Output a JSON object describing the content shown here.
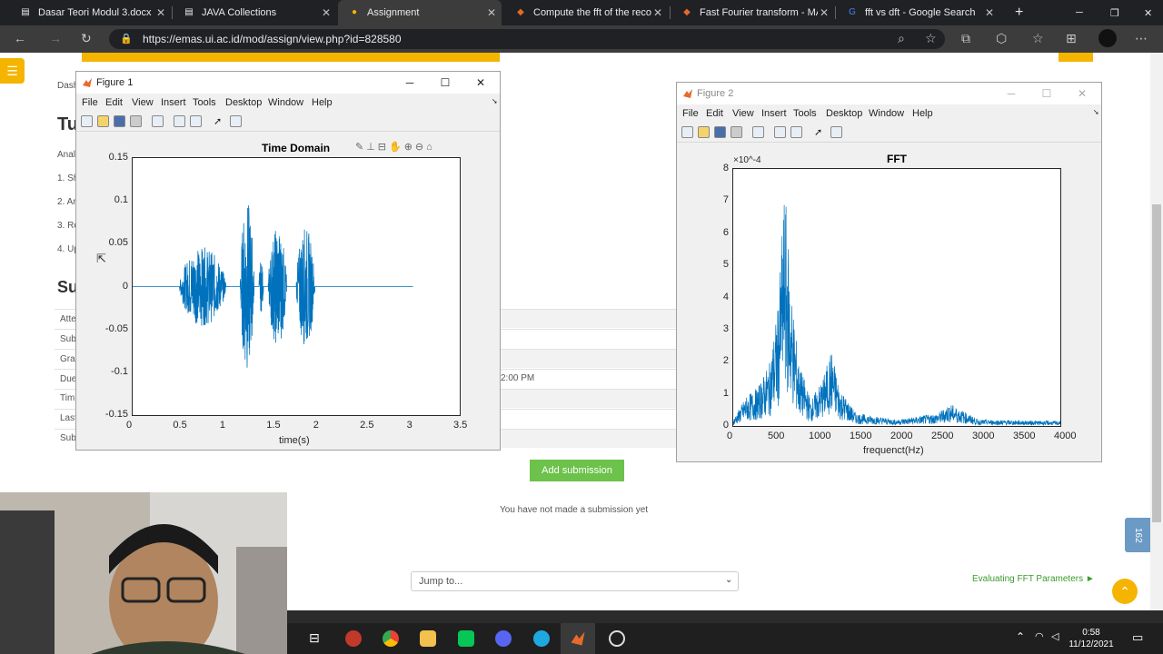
{
  "browser": {
    "tabs": [
      {
        "title": "Dasar Teori Modul 3.docx",
        "icon": "document-icon"
      },
      {
        "title": "JAVA Collections",
        "icon": "document-icon"
      },
      {
        "title": "Assignment",
        "icon": "moodle-icon"
      },
      {
        "title": "Compute the fft of the recon",
        "icon": "matlab-icon"
      },
      {
        "title": "Fast Fourier transform - MAT",
        "icon": "matlab-icon"
      },
      {
        "title": "fft vs dft - Google Search",
        "icon": "google-icon"
      }
    ],
    "new_tab_label": "+",
    "url": "https://emas.ui.ac.id/mod/assign/view.php?id=828580"
  },
  "moodle": {
    "breadcrumb": "Dash",
    "heading_partial": "Tu",
    "subheading_partial": "Su",
    "intro_partial": "Anal",
    "steps": [
      "1. Sh",
      "2. Ar",
      "3. Re",
      "4. Up"
    ],
    "status_rows": [
      "Atte",
      "Sub",
      "Gra",
      "Due",
      "Tim",
      "Last",
      "Sub"
    ],
    "due_time_partial": "2:00 PM",
    "add_submission_label": "Add submission",
    "no_submission_text": "You have not made a submission yet",
    "jump_to_placeholder": "Jump to...",
    "next_activity_label": "Evaluating FFT Parameters ►",
    "side_badge": "162"
  },
  "figure1": {
    "window_title": "Figure 1",
    "menu": [
      "File",
      "Edit",
      "View",
      "Insert",
      "Tools",
      "Desktop",
      "Window",
      "Help"
    ],
    "chart_data": {
      "type": "line",
      "title": "Time Domain",
      "xlabel": "time(s)",
      "ylabel": "",
      "xlim": [
        0,
        3.5
      ],
      "ylim": [
        -0.15,
        0.15
      ],
      "xticks": [
        "0",
        "0.5",
        "1",
        "1.5",
        "2",
        "2.5",
        "3",
        "3.5"
      ],
      "yticks": [
        "0.15",
        "0.1",
        "0.05",
        "0",
        "-0.05",
        "-0.1",
        "-0.15"
      ],
      "color": "#0072bd",
      "segments": [
        {
          "t0": 0.0,
          "t1": 0.5,
          "amp": 0.0
        },
        {
          "t0": 0.5,
          "t1": 1.0,
          "amp": 0.046
        },
        {
          "t0": 1.0,
          "t1": 1.15,
          "amp": 0.0
        },
        {
          "t0": 1.15,
          "t1": 1.3,
          "amp": 0.1
        },
        {
          "t0": 1.3,
          "t1": 1.35,
          "amp": 0.0
        },
        {
          "t0": 1.35,
          "t1": 1.4,
          "amp": 0.03
        },
        {
          "t0": 1.4,
          "t1": 1.45,
          "amp": 0.0
        },
        {
          "t0": 1.45,
          "t1": 1.65,
          "amp": 0.07
        },
        {
          "t0": 1.65,
          "t1": 1.75,
          "amp": 0.0
        },
        {
          "t0": 1.75,
          "t1": 1.95,
          "amp": 0.07
        },
        {
          "t0": 1.95,
          "t1": 3.0,
          "amp": 0.0
        }
      ]
    }
  },
  "figure2": {
    "window_title": "Figure 2",
    "menu": [
      "File",
      "Edit",
      "View",
      "Insert",
      "Tools",
      "Desktop",
      "Window",
      "Help"
    ],
    "chart_data": {
      "type": "line",
      "title": "FFT",
      "xlabel": "frequenct(Hz)",
      "ylabel": "",
      "y_exponent": "×10^-4",
      "xlim": [
        0,
        4000
      ],
      "ylim": [
        0,
        8
      ],
      "xticks": [
        "0",
        "500",
        "1000",
        "1500",
        "2000",
        "2500",
        "3000",
        "3500",
        "4000"
      ],
      "yticks": [
        "8",
        "7",
        "6",
        "5",
        "4",
        "3",
        "2",
        "1",
        "0"
      ],
      "color": "#0072bd",
      "envelope": [
        {
          "f": 0,
          "amp": 0.2
        },
        {
          "f": 150,
          "amp": 0.9
        },
        {
          "f": 300,
          "amp": 1.2
        },
        {
          "f": 450,
          "amp": 2.0
        },
        {
          "f": 550,
          "amp": 3.8
        },
        {
          "f": 630,
          "amp": 7.5
        },
        {
          "f": 700,
          "amp": 4.5
        },
        {
          "f": 800,
          "amp": 2.0
        },
        {
          "f": 950,
          "amp": 0.8
        },
        {
          "f": 1100,
          "amp": 1.5
        },
        {
          "f": 1200,
          "amp": 2.4
        },
        {
          "f": 1300,
          "amp": 1.2
        },
        {
          "f": 1500,
          "amp": 0.4
        },
        {
          "f": 2000,
          "amp": 0.2
        },
        {
          "f": 2500,
          "amp": 0.4
        },
        {
          "f": 2650,
          "amp": 0.7
        },
        {
          "f": 3000,
          "amp": 0.2
        },
        {
          "f": 4000,
          "amp": 0.15
        }
      ]
    }
  },
  "taskbar": {
    "time": "0:58",
    "date": "11/12/2021"
  }
}
